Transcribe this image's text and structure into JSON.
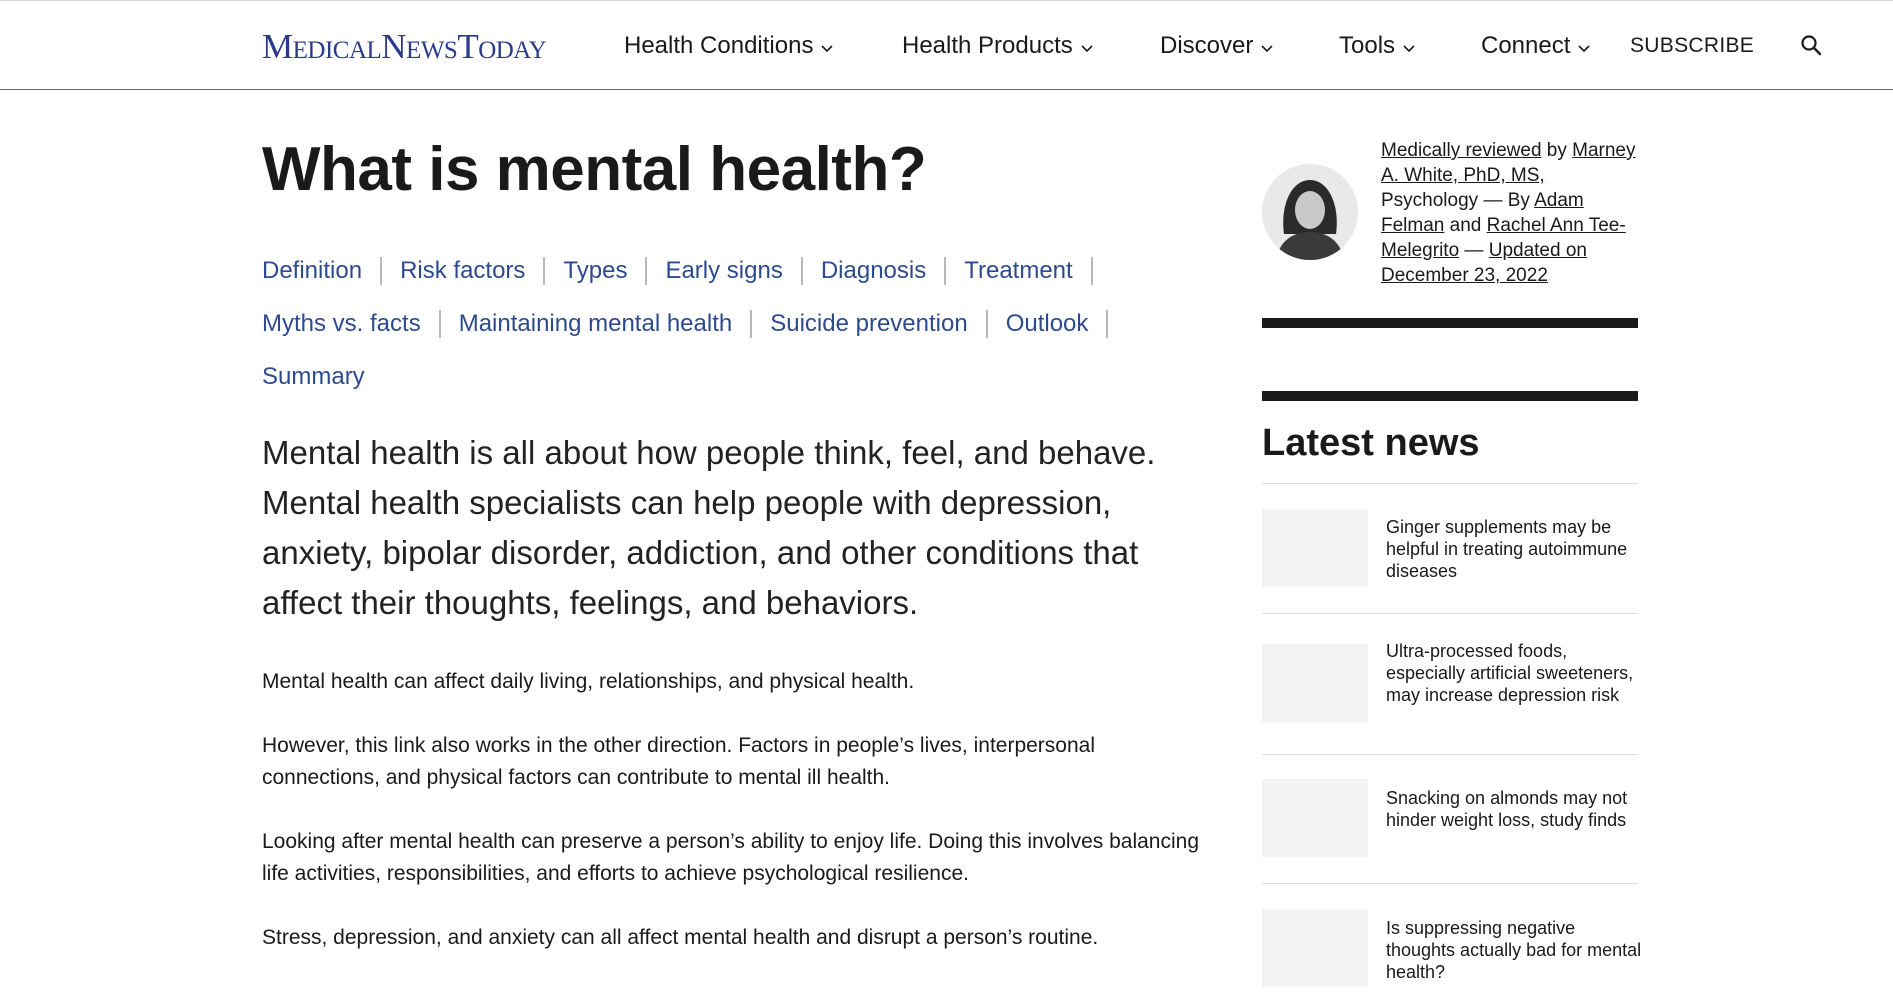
{
  "header": {
    "logo": "MedicalNewsToday",
    "nav": [
      {
        "label": "Health Conditions"
      },
      {
        "label": "Health Products"
      },
      {
        "label": "Discover"
      },
      {
        "label": "Tools"
      },
      {
        "label": "Connect"
      }
    ],
    "subscribe_label": "SUBSCRIBE",
    "search_icon": "search-icon"
  },
  "article": {
    "title": "What is mental health?",
    "toc": [
      "Definition",
      "Risk factors",
      "Types",
      "Early signs",
      "Diagnosis",
      "Treatment",
      "Myths vs. facts",
      "Maintaining mental health",
      "Suicide prevention",
      "Outlook",
      "Summary"
    ],
    "lead": "Mental health is all about how people think, feel, and behave. Mental health specialists can help people with depression, anxiety, bipolar disorder, addiction, and other conditions that affect their thoughts, feelings, and behaviors.",
    "paragraphs": [
      "Mental health can affect daily living, relationships, and physical health.",
      "However, this link also works in the other direction. Factors in people’s lives, interpersonal connections, and physical factors can contribute to mental ill health.",
      "Looking after mental health can preserve a person’s ability to enjoy life. Doing this involves balancing life activities, responsibilities, and efforts to achieve psychological resilience.",
      "Stress, depression, and anxiety can all affect mental health and disrupt a person’s routine."
    ]
  },
  "sidebar": {
    "byline": {
      "reviewed": "Medically reviewed",
      "by": " by ",
      "reviewer": "Marney A. White, PhD, MS,",
      "field": " Psychology — By ",
      "author1": "Adam Felman",
      "and": " and ",
      "author2": "Rachel Ann Tee-Melegrito",
      "dash": " — ",
      "updated": "Updated on December 23, 2022"
    },
    "latest_title": "Latest news",
    "news": [
      "Ginger supplements may be helpful in treating autoimmune diseases",
      "Ultra-processed foods, especially artificial sweeteners, may increase depression risk",
      "Snacking on almonds may not hinder weight loss, study finds",
      "Is suppressing negative thoughts actually bad for mental health?"
    ]
  },
  "colors": {
    "brand": "#2b3a8c",
    "link": "#2d4a8f",
    "text": "#1a1a1a"
  }
}
